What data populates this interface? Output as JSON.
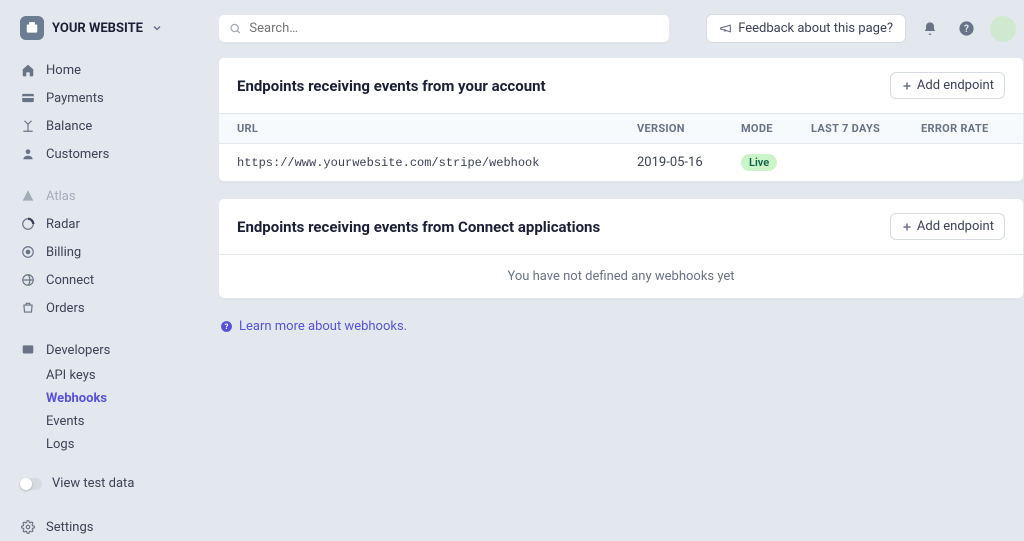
{
  "brand": {
    "name": "YOUR WEBSITE"
  },
  "search": {
    "placeholder": "Search…"
  },
  "topbar": {
    "feedback": "Feedback about this page?"
  },
  "nav": {
    "home": "Home",
    "payments": "Payments",
    "balance": "Balance",
    "customers": "Customers",
    "atlas": "Atlas",
    "radar": "Radar",
    "billing": "Billing",
    "connect": "Connect",
    "orders": "Orders",
    "developers": "Developers",
    "api_keys": "API keys",
    "webhooks": "Webhooks",
    "events": "Events",
    "logs": "Logs",
    "view_test_data": "View test data",
    "settings": "Settings"
  },
  "sections": {
    "account": {
      "title": "Endpoints receiving events from your account",
      "add_label": "Add endpoint",
      "columns": {
        "url": "URL",
        "version": "VERSION",
        "mode": "MODE",
        "last7": "LAST 7 DAYS",
        "error": "ERROR RATE"
      },
      "rows": [
        {
          "url": "https://www.yourwebsite.com/stripe/webhook",
          "version": "2019-05-16",
          "mode": "Live"
        }
      ]
    },
    "connect": {
      "title": "Endpoints receiving events from Connect applications",
      "add_label": "Add endpoint",
      "empty": "You have not defined any webhooks yet"
    }
  },
  "learn_more": "Learn more about webhooks."
}
